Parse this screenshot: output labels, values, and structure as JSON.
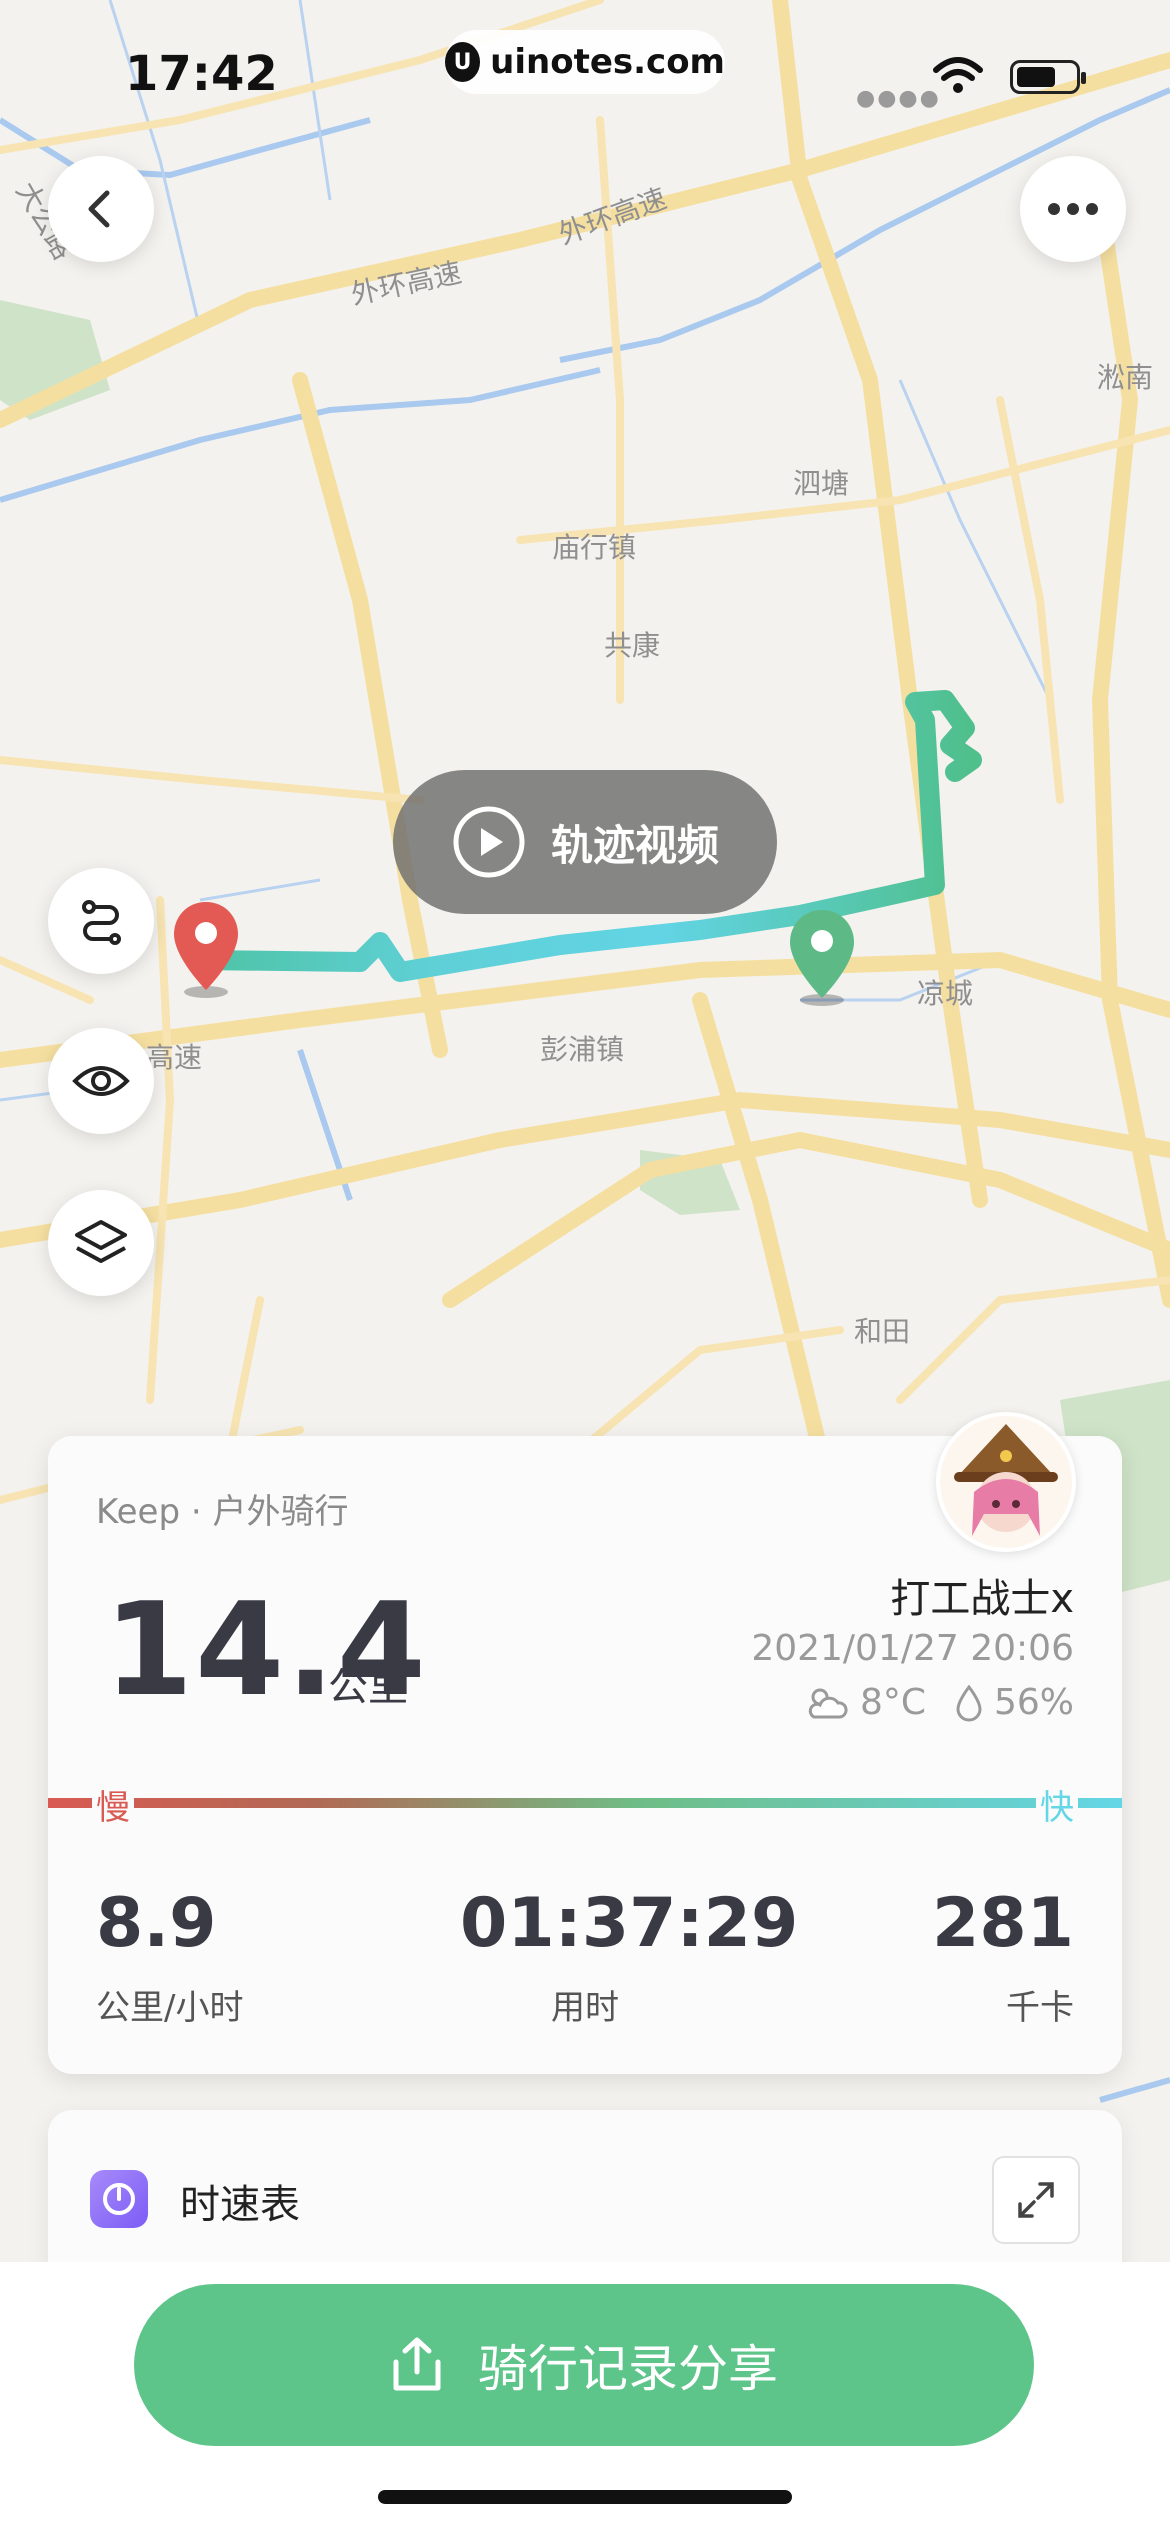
{
  "status_bar": {
    "time": "17:42",
    "url": "uinotes.com"
  },
  "map": {
    "labels": {
      "outer_ring_1": "外环高速",
      "outer_ring_2": "外环高速",
      "songnan": "淞南",
      "sitang": "泗塘",
      "miaohang": "庙行镇",
      "gongkang": "共康",
      "liangcheng": "凉城",
      "pengpu": "彭浦镇",
      "hetian": "和田",
      "gaosu": "高速",
      "road_left": "大公路"
    },
    "route_colors": {
      "slow": "#d95a52",
      "mid": "#6fbd86",
      "fast": "#64d6e6"
    }
  },
  "video_button": {
    "label": "轨迹视频"
  },
  "stats": {
    "source": "Keep · 户外骑行",
    "distance": "14.4",
    "distance_unit": "公里",
    "username": "打工战士x",
    "datetime": "2021/01/27 20:06",
    "temperature": "8°C",
    "humidity": "56%",
    "slow_label": "慢",
    "fast_label": "快",
    "speed_value": "8.9",
    "speed_label": "公里/小时",
    "duration_value": "01:37:29",
    "duration_label": "用时",
    "calories_value": "281",
    "calories_label": "千卡"
  },
  "speedometer": {
    "title": "时速表"
  },
  "share_button": {
    "label": "骑行记录分享"
  },
  "colors": {
    "accent": "#5dc58a",
    "start_pin": "#5dba87",
    "end_pin": "#e35a54"
  }
}
